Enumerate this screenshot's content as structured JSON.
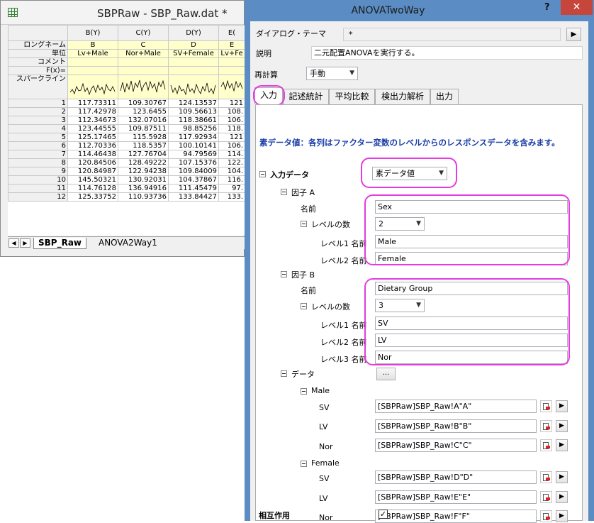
{
  "sheet": {
    "title": "SBPRaw - SBP_Raw.dat *",
    "columns": [
      "B(Y)",
      "C(Y)",
      "D(Y)",
      "E("
    ],
    "label_rows": [
      {
        "label": "ロングネーム",
        "values": [
          "B",
          "C",
          "D",
          "E"
        ]
      },
      {
        "label": "単位",
        "values": [
          "Lv+Male",
          "Nor+Male",
          "SV+Female",
          "Lv+Fe"
        ]
      },
      {
        "label": "コメント",
        "values": [
          "",
          "",
          "",
          ""
        ]
      },
      {
        "label": "F(x)=",
        "values": [
          "",
          "",
          "",
          ""
        ]
      }
    ],
    "sparkline_label": "スパークライン",
    "rows": [
      {
        "n": "1",
        "v": [
          "117.73311",
          "109.30767",
          "124.13537",
          "121"
        ]
      },
      {
        "n": "2",
        "v": [
          "117.42978",
          "123.6455",
          "109.56613",
          "108."
        ]
      },
      {
        "n": "3",
        "v": [
          "112.34673",
          "132.07016",
          "118.38661",
          "106."
        ]
      },
      {
        "n": "4",
        "v": [
          "123.44555",
          "109.87511",
          "98.85256",
          "118."
        ]
      },
      {
        "n": "5",
        "v": [
          "125.17465",
          "115.5928",
          "117.92934",
          "121"
        ]
      },
      {
        "n": "6",
        "v": [
          "112.70336",
          "118.5357",
          "100.10141",
          "106."
        ]
      },
      {
        "n": "7",
        "v": [
          "114.46438",
          "127.76704",
          "94.79569",
          "114."
        ]
      },
      {
        "n": "8",
        "v": [
          "120.84506",
          "128.49222",
          "107.15376",
          "122."
        ]
      },
      {
        "n": "9",
        "v": [
          "120.84987",
          "122.94238",
          "109.84009",
          "104."
        ]
      },
      {
        "n": "10",
        "v": [
          "145.50321",
          "130.92031",
          "104.37867",
          "116."
        ]
      },
      {
        "n": "11",
        "v": [
          "114.76128",
          "136.94916",
          "111.45479",
          "97."
        ]
      },
      {
        "n": "12",
        "v": [
          "125.33752",
          "110.93736",
          "133.84427",
          "133."
        ]
      }
    ],
    "tabs": [
      "SBP_Raw",
      "ANOVA2Way1"
    ]
  },
  "dialog": {
    "title": "ANOVATwoWay",
    "help": "?",
    "close": "✕",
    "theme_label": "ダイアログ・テーマ",
    "theme_value": "*",
    "desc_label": "説明",
    "desc_value": "二元配置ANOVAを実行する。",
    "recalc_label": "再計算",
    "recalc_value": "手動",
    "tabs": [
      "入力",
      "記述統計",
      "平均比較",
      "検出力解析",
      "出力"
    ],
    "note": "素データ値：各列はファクター変数のレベルからのレスポンスデータを含みます。",
    "input_data_label": "入力データ",
    "input_data_value": "素データ値",
    "factor_a": {
      "label": "因子 A",
      "name_label": "名前",
      "name_value": "Sex",
      "levels_label": "レベルの数",
      "levels_value": "2",
      "level_labels": [
        "レベル1 名前",
        "レベル2 名前"
      ],
      "level_values": [
        "Male",
        "Female"
      ]
    },
    "factor_b": {
      "label": "因子 B",
      "name_label": "名前",
      "name_value": "Dietary Group",
      "levels_label": "レベルの数",
      "levels_value": "3",
      "level_labels": [
        "レベル1 名前",
        "レベル2 名前",
        "レベル3 名前"
      ],
      "level_values": [
        "SV",
        "LV",
        "Nor"
      ]
    },
    "data_label": "データ",
    "data_button": "...",
    "male_label": "Male",
    "female_label": "Female",
    "male_rows": [
      {
        "label": "SV",
        "value": "[SBPRaw]SBP_Raw!A\"A\""
      },
      {
        "label": "LV",
        "value": "[SBPRaw]SBP_Raw!B\"B\""
      },
      {
        "label": "Nor",
        "value": "[SBPRaw]SBP_Raw!C\"C\""
      }
    ],
    "female_rows": [
      {
        "label": "SV",
        "value": "[SBPRaw]SBP_Raw!D\"D\""
      },
      {
        "label": "LV",
        "value": "[SBPRaw]SBP_Raw!E\"E\""
      },
      {
        "label": "Nor",
        "value": "[SBPRaw]SBP_Raw!F\"F\""
      }
    ],
    "interaction_label": "相互作用",
    "interaction_checked": "✓"
  }
}
